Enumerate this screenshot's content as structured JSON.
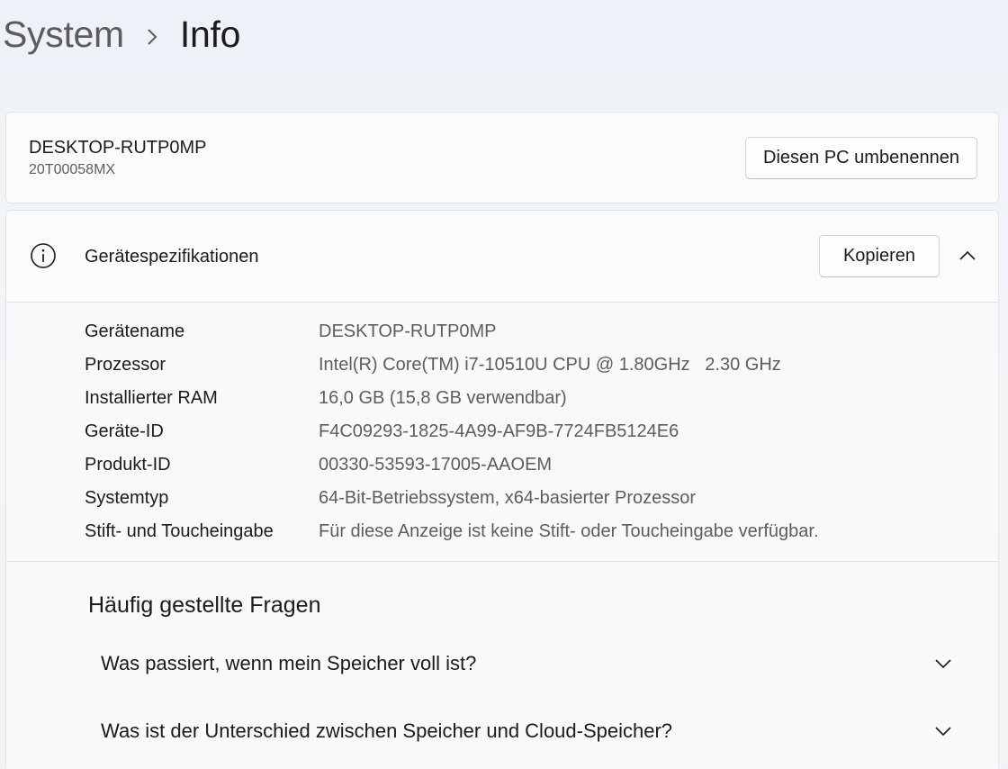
{
  "breadcrumb": {
    "parent": "System",
    "separator_icon": "chevron-right-icon",
    "current": "Info"
  },
  "device_card": {
    "name": "DESKTOP-RUTP0MP",
    "model": "20T00058MX",
    "rename_button": "Diesen PC umbenennen"
  },
  "specs": {
    "icon": "info-icon",
    "title": "Gerätespezifikationen",
    "copy_button": "Kopieren",
    "collapse_icon": "chevron-up-icon",
    "rows": [
      {
        "label": "Gerätename",
        "value": "DESKTOP-RUTP0MP"
      },
      {
        "label": "Prozessor",
        "value": "Intel(R) Core(TM) i7-10510U CPU @ 1.80GHz   2.30 GHz"
      },
      {
        "label": "Installierter RAM",
        "value": "16,0 GB (15,8 GB verwendbar)"
      },
      {
        "label": "Geräte-ID",
        "value": "F4C09293-1825-4A99-AF9B-7724FB5124E6"
      },
      {
        "label": "Produkt-ID",
        "value": "00330-53593-17005-AAOEM"
      },
      {
        "label": "Systemtyp",
        "value": "64-Bit-Betriebssystem, x64-basierter Prozessor"
      },
      {
        "label": "Stift- und Toucheingabe",
        "value": "Für diese Anzeige ist keine Stift- oder Toucheingabe verfügbar."
      }
    ]
  },
  "faq": {
    "title": "Häufig gestellte Fragen",
    "items": [
      {
        "question": "Was passiert, wenn mein Speicher voll ist?",
        "icon": "chevron-down-icon"
      },
      {
        "question": "Was ist der Unterschied zwischen Speicher und Cloud-Speicher?",
        "icon": "chevron-down-icon"
      }
    ]
  }
}
